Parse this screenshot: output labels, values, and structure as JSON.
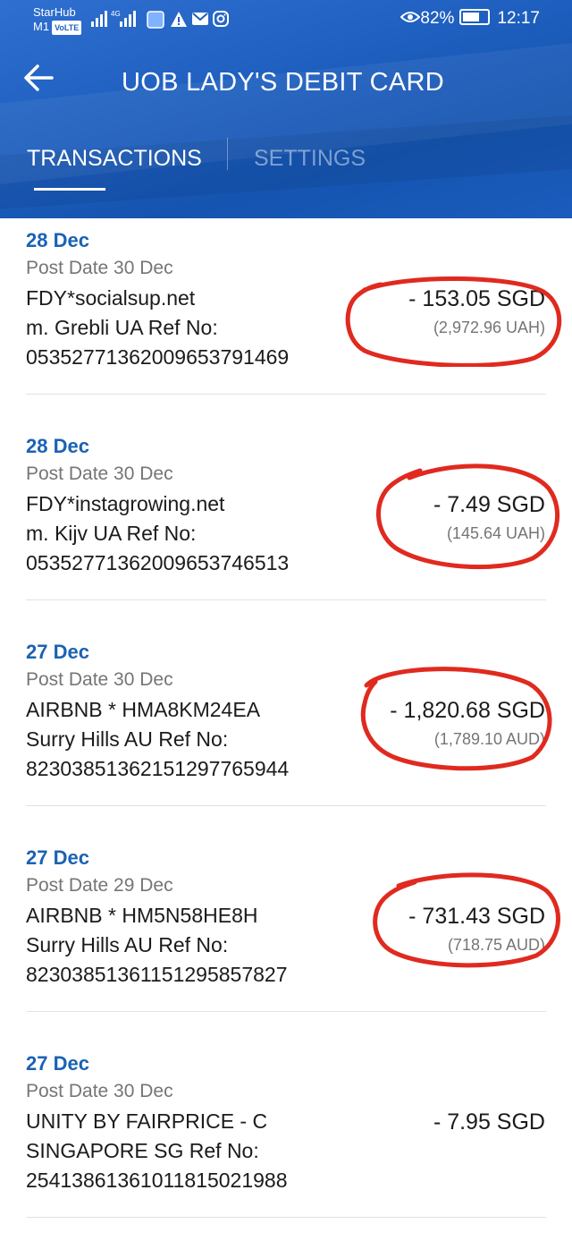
{
  "status_bar": {
    "carrier_top": "StarHub",
    "carrier_bottom": "M1",
    "volte": "VoLTE",
    "battery_percent": "82%",
    "battery_level": 0.82,
    "time": "12:17"
  },
  "header": {
    "title": "UOB LADY'S DEBIT CARD",
    "tabs": [
      {
        "label": "TRANSACTIONS",
        "active": true
      },
      {
        "label": "SETTINGS",
        "active": false
      }
    ]
  },
  "transactions": [
    {
      "date": "28 Dec",
      "post_date": "Post Date 30 Dec",
      "merchant": "FDY*socialsup.net",
      "location": "m. Grebli UA Ref No:",
      "ref": "05352771362009653791469",
      "amount": "- 153.05 SGD",
      "foreign": "(2,972.96 UAH)",
      "circled": true
    },
    {
      "date": "28 Dec",
      "post_date": "Post Date 30 Dec",
      "merchant": "FDY*instagrowing.net",
      "location": "m. Kijv UA Ref No:",
      "ref": "05352771362009653746513",
      "amount": "- 7.49 SGD",
      "foreign": "(145.64 UAH)",
      "circled": true
    },
    {
      "date": "27 Dec",
      "post_date": "Post Date 30 Dec",
      "merchant": "AIRBNB * HMA8KM24EA",
      "location": "Surry Hills AU Ref No:",
      "ref": "82303851362151297765944",
      "amount": "- 1,820.68 SGD",
      "foreign": "(1,789.10 AUD)",
      "circled": true
    },
    {
      "date": "27 Dec",
      "post_date": "Post Date 29 Dec",
      "merchant": "AIRBNB * HM5N58HE8H",
      "location": "Surry Hills AU Ref No:",
      "ref": "82303851361151295857827",
      "amount": "- 731.43 SGD",
      "foreign": "(718.75 AUD)",
      "circled": true
    },
    {
      "date": "27 Dec",
      "post_date": "Post Date 30 Dec",
      "merchant": "UNITY BY FAIRPRICE - C",
      "location": "SINGAPORE SG Ref No:",
      "ref": "25413861361011815021988",
      "amount": "- 7.95 SGD",
      "foreign": "",
      "circled": false
    }
  ],
  "colors": {
    "header_blue": "#1e5fbf",
    "date_blue": "#1a62b4",
    "annotation_red": "#e02a1f"
  }
}
